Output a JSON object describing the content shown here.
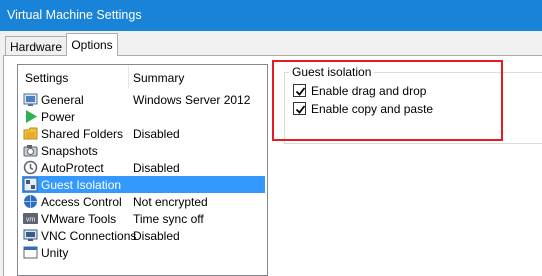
{
  "window": {
    "title": "Virtual Machine Settings"
  },
  "tabs": [
    {
      "label": "Hardware",
      "active": false
    },
    {
      "label": "Options",
      "active": true
    }
  ],
  "settings_list": {
    "headers": {
      "settings": "Settings",
      "summary": "Summary"
    },
    "items": [
      {
        "label": "General",
        "summary": "Windows Server 2012",
        "icon": "general-icon",
        "selected": false
      },
      {
        "label": "Power",
        "summary": "",
        "icon": "power-play-icon",
        "selected": false
      },
      {
        "label": "Shared Folders",
        "summary": "Disabled",
        "icon": "shared-folders-icon",
        "selected": false
      },
      {
        "label": "Snapshots",
        "summary": "",
        "icon": "snapshots-icon",
        "selected": false
      },
      {
        "label": "AutoProtect",
        "summary": "Disabled",
        "icon": "autoprotect-icon",
        "selected": false
      },
      {
        "label": "Guest Isolation",
        "summary": "",
        "icon": "guest-isolation-icon",
        "selected": true
      },
      {
        "label": "Access Control",
        "summary": "Not encrypted",
        "icon": "access-control-icon",
        "selected": false
      },
      {
        "label": "VMware Tools",
        "summary": "Time sync off",
        "icon": "vmware-tools-icon",
        "selected": false
      },
      {
        "label": "VNC Connections",
        "summary": "Disabled",
        "icon": "vnc-connections-icon",
        "selected": false
      },
      {
        "label": "Unity",
        "summary": "",
        "icon": "unity-icon",
        "selected": false
      }
    ]
  },
  "guest_isolation": {
    "group_title": "Guest isolation",
    "options": [
      {
        "label": "Enable drag and drop",
        "checked": true
      },
      {
        "label": "Enable copy and paste",
        "checked": true
      }
    ]
  },
  "colors": {
    "titlebar": "#1883d7",
    "selection": "#3399ff",
    "highlight_box": "#e31b23",
    "play_green": "#2bb24c"
  }
}
